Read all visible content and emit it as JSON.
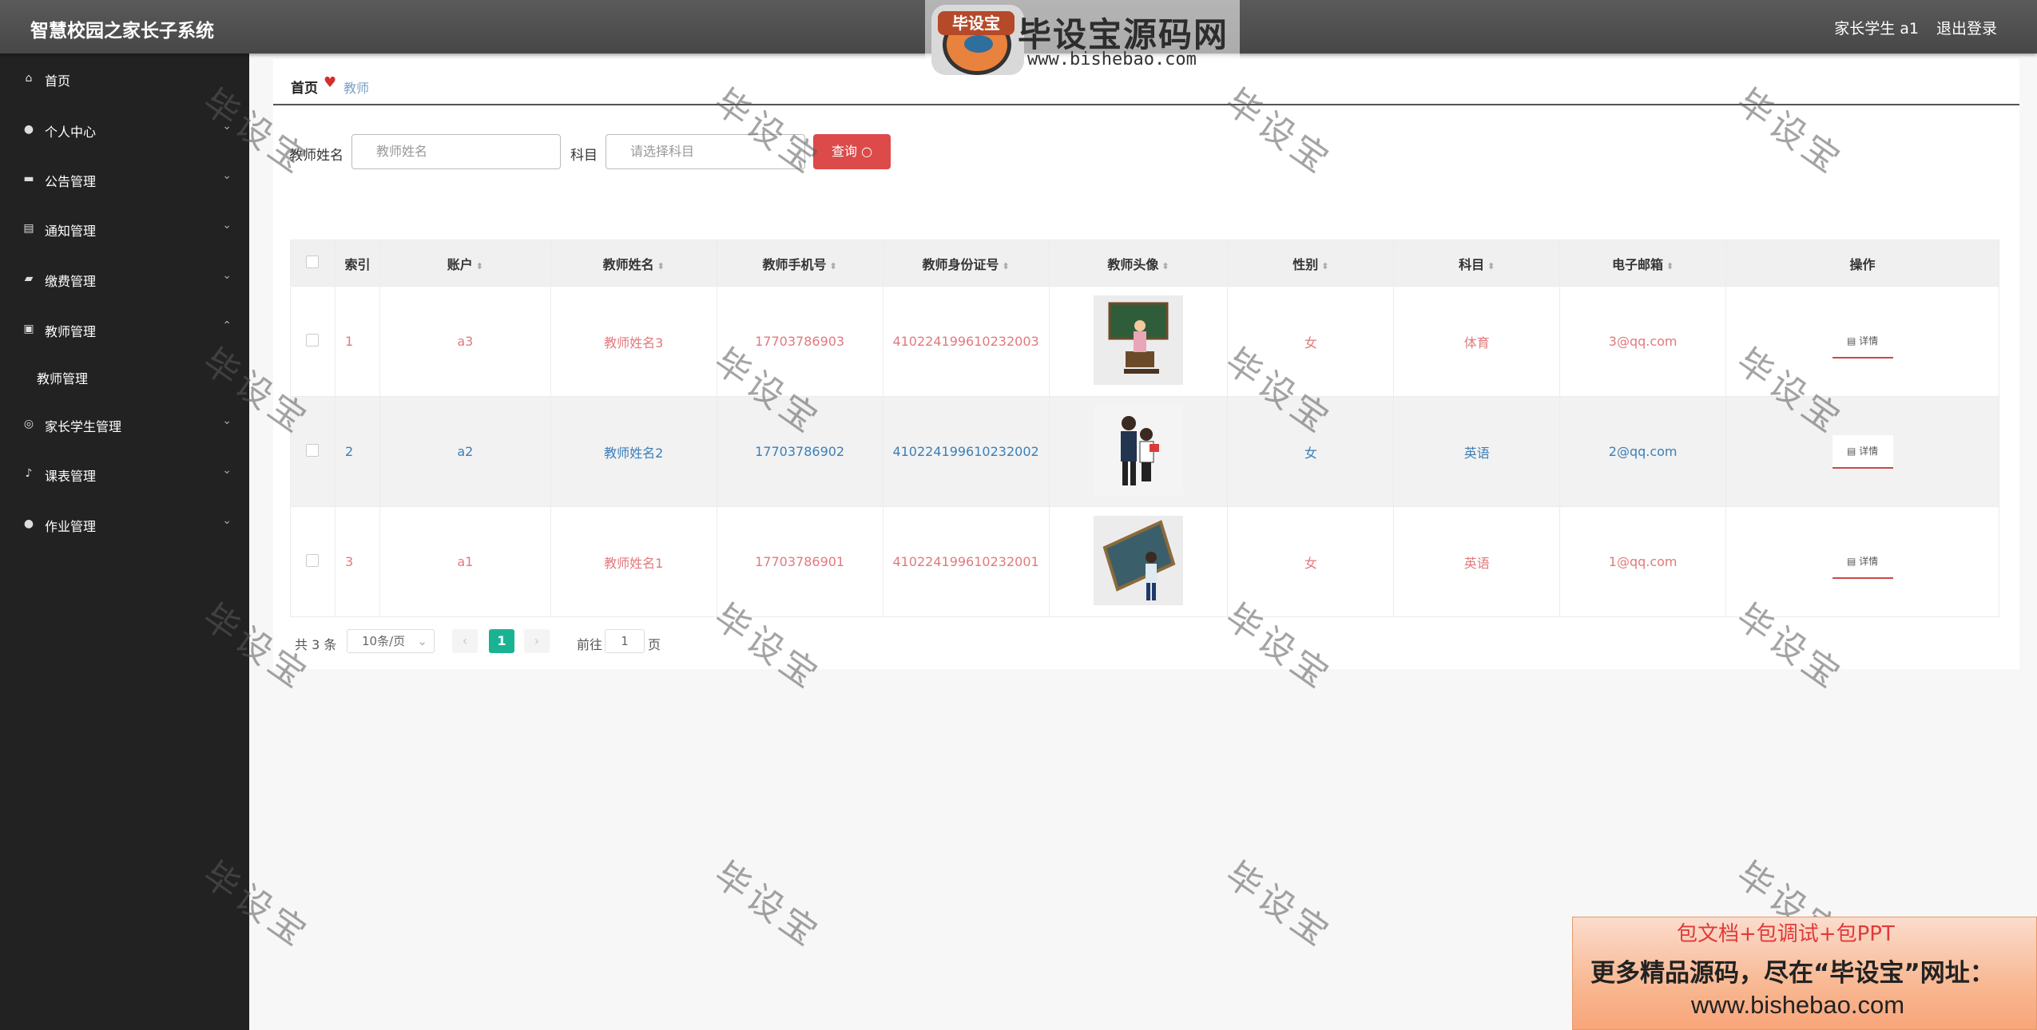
{
  "header": {
    "app_title": "智慧校园之家长子系统",
    "user": "家长学生 a1",
    "logout": "退出登录"
  },
  "brand": {
    "logo_text": "毕设宝",
    "name": "毕设宝源码网",
    "url": "www.bishebao.com"
  },
  "sidebar": {
    "items": [
      {
        "label": "首页",
        "icon": "home-icon"
      },
      {
        "label": "个人中心",
        "icon": "user-icon"
      },
      {
        "label": "公告管理",
        "icon": "briefcase-icon"
      },
      {
        "label": "通知管理",
        "icon": "chart-icon"
      },
      {
        "label": "缴费管理",
        "icon": "comment-icon"
      },
      {
        "label": "教师管理",
        "icon": "clipboard-icon"
      },
      {
        "label": "家长学生管理",
        "icon": "globe-icon"
      },
      {
        "label": "课表管理",
        "icon": "bell-icon"
      },
      {
        "label": "作业管理",
        "icon": "user-icon"
      }
    ],
    "sub_item": "教师管理"
  },
  "breadcrumb": {
    "home": "首页",
    "current": "教师"
  },
  "search": {
    "name_label": "教师姓名",
    "name_placeholder": "教师姓名",
    "subject_label": "科目",
    "subject_placeholder": "请选择科目",
    "button": "查询"
  },
  "table": {
    "headers": [
      "索引",
      "账户",
      "教师姓名",
      "教师手机号",
      "教师身份证号",
      "教师头像",
      "性别",
      "科目",
      "电子邮箱",
      "操作"
    ],
    "rows": [
      {
        "index": "1",
        "account": "a3",
        "name": "教师姓名3",
        "phone": "17703786903",
        "id_no": "410224199610232003",
        "gender": "女",
        "subject": "体育",
        "email": "3@qq.com",
        "action": "详情"
      },
      {
        "index": "2",
        "account": "a2",
        "name": "教师姓名2",
        "phone": "17703786902",
        "id_no": "410224199610232002",
        "gender": "女",
        "subject": "英语",
        "email": "2@qq.com",
        "action": "详情"
      },
      {
        "index": "3",
        "account": "a1",
        "name": "教师姓名1",
        "phone": "17703786901",
        "id_no": "410224199610232001",
        "gender": "女",
        "subject": "英语",
        "email": "1@qq.com",
        "action": "详情"
      }
    ]
  },
  "pagination": {
    "total": "共 3 条",
    "page_size": "10条/页",
    "current_page": "1",
    "goto_prefix": "前往",
    "goto_value": "1",
    "goto_suffix": "页"
  },
  "watermark": "毕设宝",
  "promo": {
    "line1": "包文档+包调试+包PPT",
    "line2": "更多精品源码，尽在“毕设宝”网址：",
    "line3": "www.bishebao.com"
  },
  "colors": {
    "accent_red": "#dc4a4a",
    "link_red": "#e2797c",
    "link_blue": "#3a7fb8",
    "pager_active": "#19b394"
  }
}
